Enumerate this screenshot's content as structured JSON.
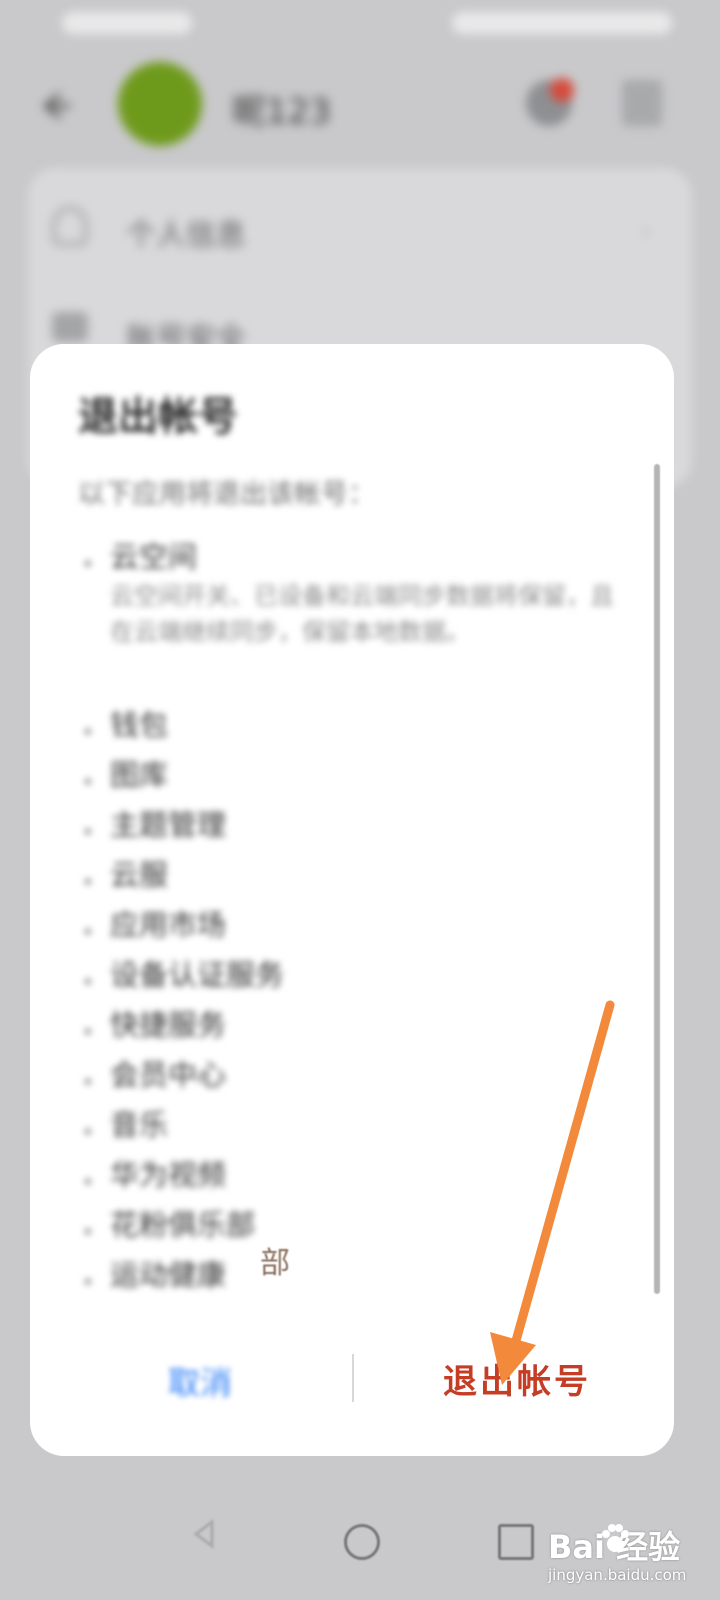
{
  "background_app": {
    "account_name": "昵123",
    "rows": [
      {
        "label": "个人信息",
        "icon": "person-icon"
      },
      {
        "label": "账号安全",
        "icon": "lock-icon"
      }
    ]
  },
  "dialog": {
    "title": "退出帐号",
    "description": "以下应用将退出该帐号：",
    "apps": [
      {
        "name": "云空间",
        "note": "云空间开关、已设备和云端同步数据将保留，且在云端继续同步，保留本地数据。"
      },
      {
        "name": "钱包"
      },
      {
        "name": "图库"
      },
      {
        "name": "主题管理"
      },
      {
        "name": "云服"
      },
      {
        "name": "应用市场"
      },
      {
        "name": "设备认证服务"
      },
      {
        "name": "快捷服务"
      },
      {
        "name": "会员中心"
      },
      {
        "name": "音乐"
      },
      {
        "name": "华为视频"
      },
      {
        "name": "花粉俱乐部"
      },
      {
        "name": "运动健康"
      }
    ],
    "cancel_label": "取消",
    "logout_label": "退出帐号"
  },
  "annotation": {
    "stray_char": "部",
    "arrow_color": "#f3893a"
  },
  "watermark": {
    "brand": "Bai 经验",
    "url": "jingyan.baidu.com"
  },
  "colors": {
    "accent_blue": "#2d7ef6",
    "logout_red": "#c43d24",
    "avatar_green": "#6e9a1b"
  }
}
